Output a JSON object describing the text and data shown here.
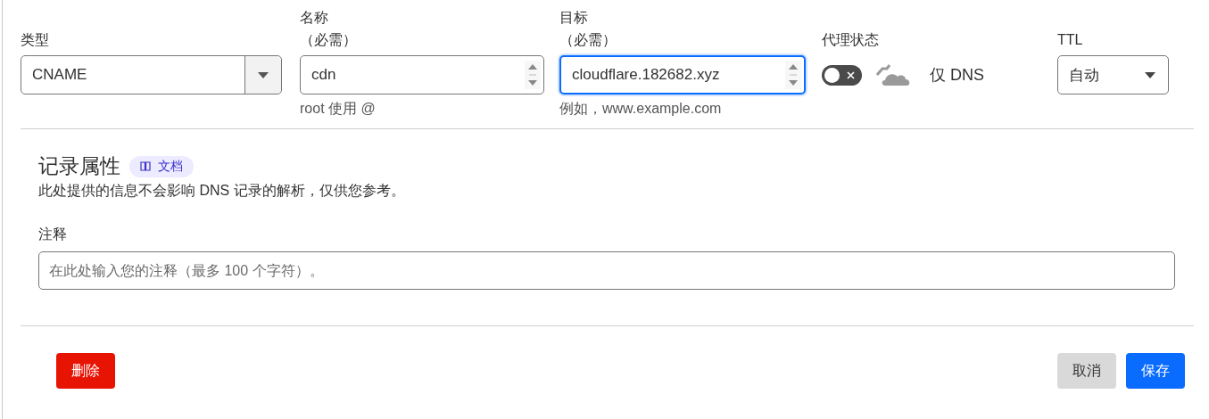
{
  "fields": [
    {
      "kind": "select",
      "label": "类型",
      "value": "CNAME"
    },
    {
      "kind": "text",
      "label": "名称",
      "required": "（必需）",
      "value": "cdn",
      "hint": "root 使用 @",
      "focused": false
    },
    {
      "kind": "text",
      "label": "目标",
      "required": "（必需）",
      "value": "cloudflare.182682.xyz",
      "hint": "例如，www.example.com",
      "focused": true
    }
  ],
  "proxy": {
    "label": "代理状态",
    "on": false,
    "status": "仅 DNS"
  },
  "ttl": {
    "label": "TTL",
    "value": "自动"
  },
  "record_attributes": {
    "title": "记录属性",
    "docs_link": "文档",
    "description": "此处提供的信息不会影响 DNS 记录的解析，仅供您参考。"
  },
  "comment": {
    "label": "注释",
    "placeholder": "在此处输入您的注释（最多 100 个字符）。"
  },
  "buttons": [
    {
      "label": "删除",
      "kind": "danger"
    },
    {
      "label": "取消",
      "kind": "secondary"
    },
    {
      "label": "保存",
      "kind": "primary"
    }
  ]
}
